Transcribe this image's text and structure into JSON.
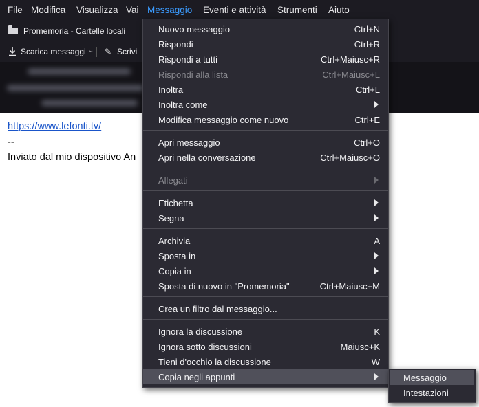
{
  "menubar": {
    "items": [
      {
        "label": "File"
      },
      {
        "label": "Modifica"
      },
      {
        "label": "Visualizza"
      },
      {
        "label": "Vai"
      },
      {
        "label": "Messaggio"
      },
      {
        "label": "Eventi e attività"
      },
      {
        "label": "Strumenti"
      },
      {
        "label": "Aiuto"
      }
    ],
    "active": "Messaggio"
  },
  "folder_bar": {
    "label": "Promemoria - Cartelle locali",
    "icon": "folder-icon"
  },
  "toolbar": {
    "download_label": "Scarica messaggi",
    "compose_label": "Scrivi",
    "icons": [
      "download-icon",
      "chevron-down-icon",
      "pencil-icon"
    ]
  },
  "message_body": {
    "link": "https://www.lefonti.tv/",
    "dash": "--",
    "signature": "Inviato dal mio dispositivo An"
  },
  "context_menu": {
    "items": [
      {
        "label": "Nuovo messaggio",
        "shortcut": "Ctrl+N"
      },
      {
        "label": "Rispondi",
        "shortcut": "Ctrl+R"
      },
      {
        "label": "Rispondi a tutti",
        "shortcut": "Ctrl+Maiusc+R"
      },
      {
        "label": "Rispondi alla lista",
        "shortcut": "Ctrl+Maiusc+L",
        "disabled": true
      },
      {
        "label": "Inoltra",
        "shortcut": "Ctrl+L"
      },
      {
        "label": "Inoltra come",
        "submenu": true
      },
      {
        "label": "Modifica messaggio come nuovo",
        "shortcut": "Ctrl+E"
      },
      {
        "label": "Apri messaggio",
        "shortcut": "Ctrl+O"
      },
      {
        "label": "Apri nella conversazione",
        "shortcut": "Ctrl+Maiusc+O"
      },
      {
        "label": "Allegati",
        "submenu": true,
        "disabled": true
      },
      {
        "label": "Etichetta",
        "submenu": true
      },
      {
        "label": "Segna",
        "submenu": true
      },
      {
        "label": "Archivia",
        "shortcut": "A"
      },
      {
        "label": "Sposta in",
        "submenu": true
      },
      {
        "label": "Copia in",
        "submenu": true
      },
      {
        "label": "Sposta di nuovo in \"Promemoria\"",
        "shortcut": "Ctrl+Maiusc+M"
      },
      {
        "label": "Crea un filtro dal messaggio..."
      },
      {
        "label": "Ignora la discussione",
        "shortcut": "K"
      },
      {
        "label": "Ignora sotto discussioni",
        "shortcut": "Maiusc+K"
      },
      {
        "label": "Tieni d'occhio la discussione",
        "shortcut": "W"
      },
      {
        "label": "Copia negli appunti",
        "submenu": true,
        "highlighted": true
      }
    ]
  },
  "submenu": {
    "items": [
      {
        "label": "Messaggio",
        "highlighted": true
      },
      {
        "label": "Intestazioni"
      }
    ]
  },
  "colors": {
    "menu_bg": "#2b2a33",
    "highlight": "#50505a",
    "active_menu": "#3b9cff",
    "link": "#1a55c9"
  }
}
